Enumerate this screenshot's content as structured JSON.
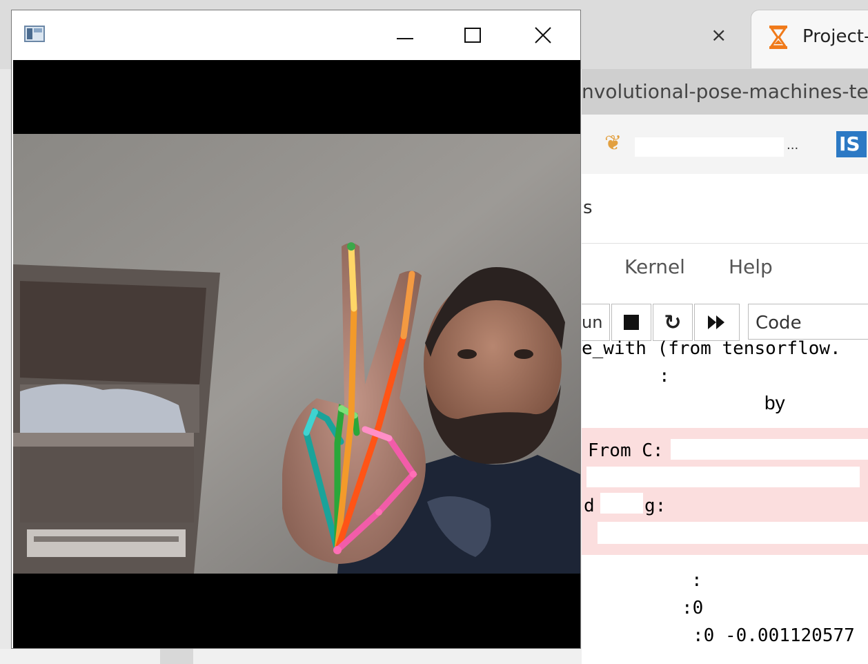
{
  "browser": {
    "active_tab_title": "Project-",
    "inactive_tab_close": "×",
    "url_fragment": "nvolutional-pose-machines-te",
    "bookmark_ellipsis": "...",
    "bookmark_badge": "IS"
  },
  "notebook": {
    "header_fragment": "s",
    "menu": {
      "kernel": "Kernel",
      "help": "Help"
    },
    "toolbar": {
      "run_fragment": "un",
      "cell_type": "Code"
    },
    "output_lines": [
      {
        "text": "e_with (from tensorflow.",
        "top": 0
      },
      {
        "text": ":",
        "top": 0
      },
      {
        "text": "by",
        "top": 0
      },
      {
        "text": "From C:",
        "top": 0
      },
      {
        "text": "d",
        "top": 0
      },
      {
        "text": "g:",
        "top": 0
      },
      {
        "text": ":",
        "top": 0
      },
      {
        "text": ":0",
        "top": 0
      },
      {
        "text": ":0 -0.001120577",
        "top": 0
      }
    ]
  },
  "cv_window": {
    "title": "",
    "buttons": {
      "minimize": "minimize",
      "maximize": "maximize",
      "close": "close"
    }
  },
  "colors": {
    "accent_orange": "#f07a1a",
    "output_error_bg": "#fbdede"
  }
}
